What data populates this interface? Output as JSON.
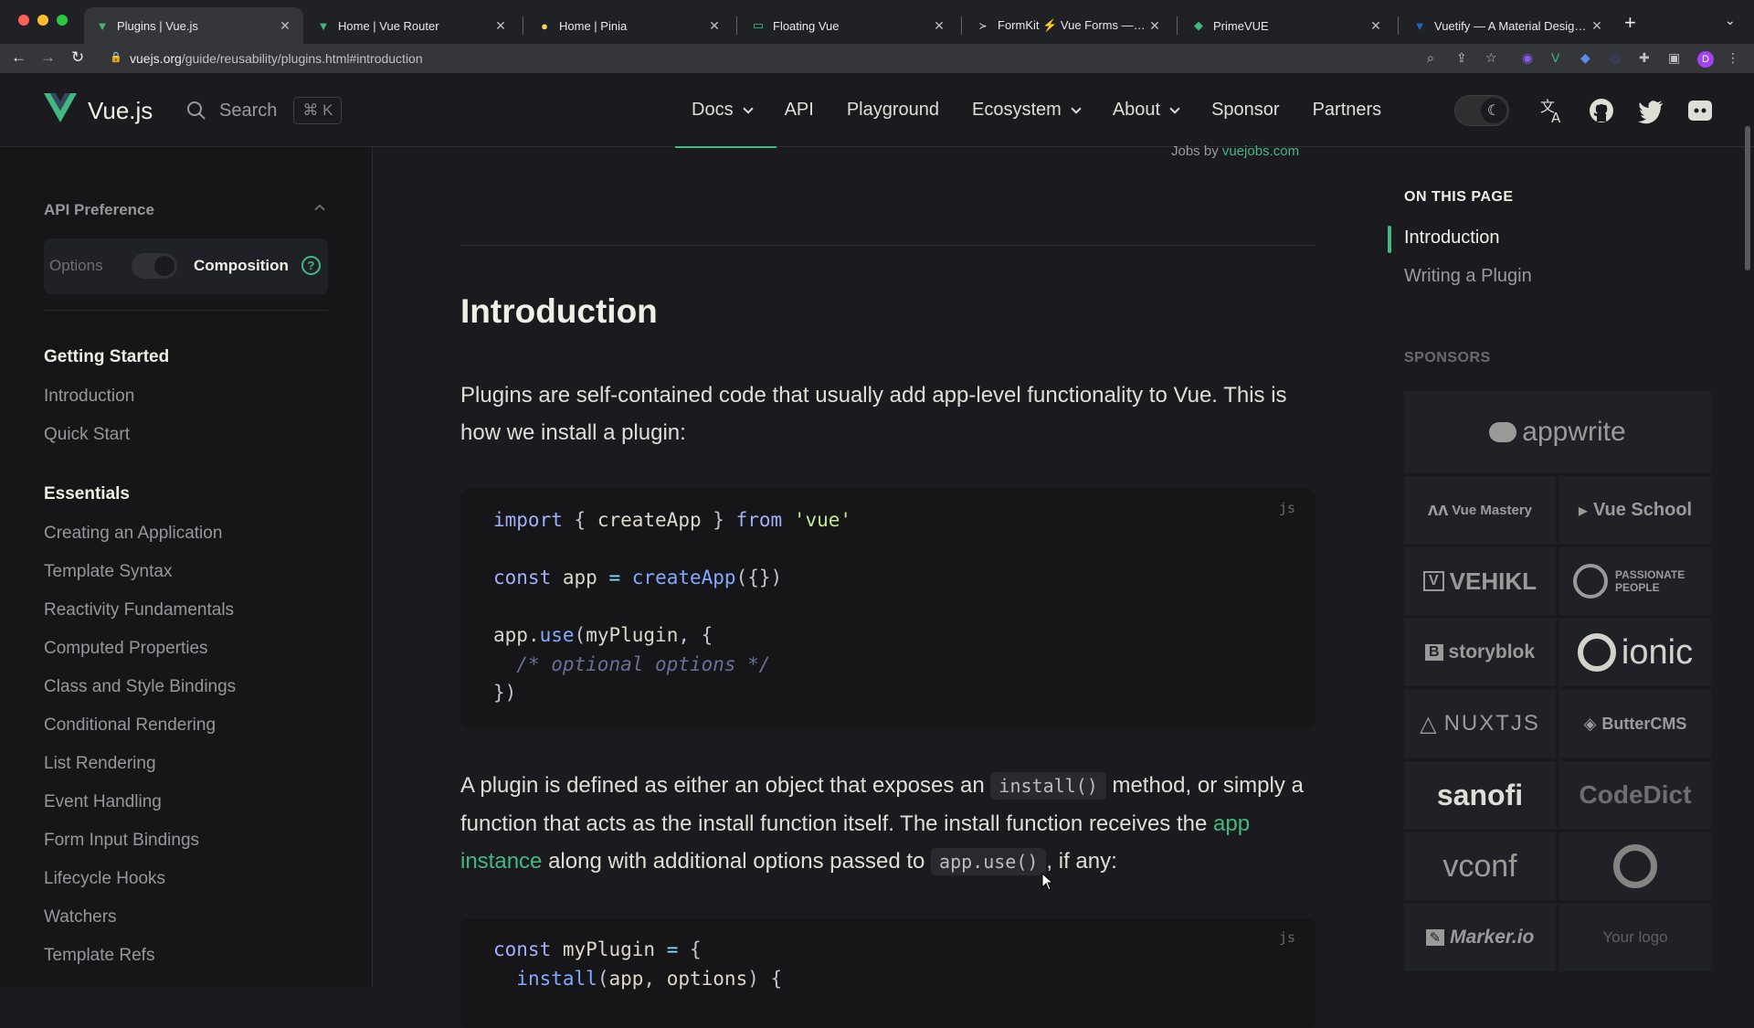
{
  "browser": {
    "tabs": [
      {
        "title": "Plugins | Vue.js",
        "icon": "vue-icon",
        "active": true
      },
      {
        "title": "Home | Vue Router",
        "icon": "vue-icon",
        "active": false
      },
      {
        "title": "Home | Pinia",
        "icon": "pinia-icon",
        "active": false
      },
      {
        "title": "Floating Vue",
        "icon": "floating-vue-icon",
        "active": false
      },
      {
        "title": "FormKit ⚡️ Vue Forms — Supe",
        "icon": "formkit-icon",
        "active": false
      },
      {
        "title": "PrimeVUE",
        "icon": "primevue-icon",
        "active": false
      },
      {
        "title": "Vuetify — A Material Design Fr",
        "icon": "vuetify-icon",
        "active": false
      }
    ],
    "url_host": "vuejs.org",
    "url_path": "/guide/reusability/plugins.html#introduction",
    "profile_initial": "D"
  },
  "nav": {
    "brand": "Vue.js",
    "search_label": "Search",
    "search_kbd": "⌘ K",
    "links": [
      {
        "label": "Docs",
        "dropdown": true
      },
      {
        "label": "API",
        "dropdown": false
      },
      {
        "label": "Playground",
        "dropdown": false
      },
      {
        "label": "Ecosystem",
        "dropdown": true
      },
      {
        "label": "About",
        "dropdown": true
      },
      {
        "label": "Sponsor",
        "dropdown": false
      },
      {
        "label": "Partners",
        "dropdown": false
      }
    ]
  },
  "sidebar": {
    "api_pref_title": "API Preference",
    "opt_options": "Options",
    "opt_composition": "Composition",
    "help": "?",
    "groups": [
      {
        "title": "Getting Started",
        "items": [
          "Introduction",
          "Quick Start"
        ]
      },
      {
        "title": "Essentials",
        "items": [
          "Creating an Application",
          "Template Syntax",
          "Reactivity Fundamentals",
          "Computed Properties",
          "Class and Style Bindings",
          "Conditional Rendering",
          "List Rendering",
          "Event Handling",
          "Form Input Bindings",
          "Lifecycle Hooks",
          "Watchers",
          "Template Refs"
        ]
      }
    ]
  },
  "main": {
    "jobs_prefix": "Jobs by",
    "jobs_link": "vuejobs.com",
    "title": "Introduction",
    "p1": "Plugins are self-contained code that usually add app-level functionality to Vue. This is how we install a plugin:",
    "code1_lang": "js",
    "p2_a": "A plugin is defined as either an object that exposes an",
    "p2_code1": "install()",
    "p2_b": "method, or simply a function that acts as the install function itself. The install function receives the",
    "p2_link": "app instance",
    "p2_c": "along with additional options passed to",
    "p2_code2": "app.use()",
    "p2_d": ", if any:",
    "code2_lang": "js"
  },
  "aside": {
    "on_this_page": "ON THIS PAGE",
    "links": [
      "Introduction",
      "Writing a Plugin"
    ],
    "sponsors_title": "SPONSORS",
    "sponsors": [
      "appwrite",
      "Vue Mastery",
      "Vue School",
      "VEHIKL",
      "PASSIONATE PEOPLE",
      "storyblok",
      "ionic",
      "NUXTJS",
      "ButterCMS",
      "sanofi",
      "CodeDict",
      "vconf",
      "",
      "Marker.io",
      "Your logo"
    ]
  },
  "colors": {
    "accent": "#42b883",
    "bg": "#1b1b1f",
    "sidebar_bg": "#161618"
  }
}
